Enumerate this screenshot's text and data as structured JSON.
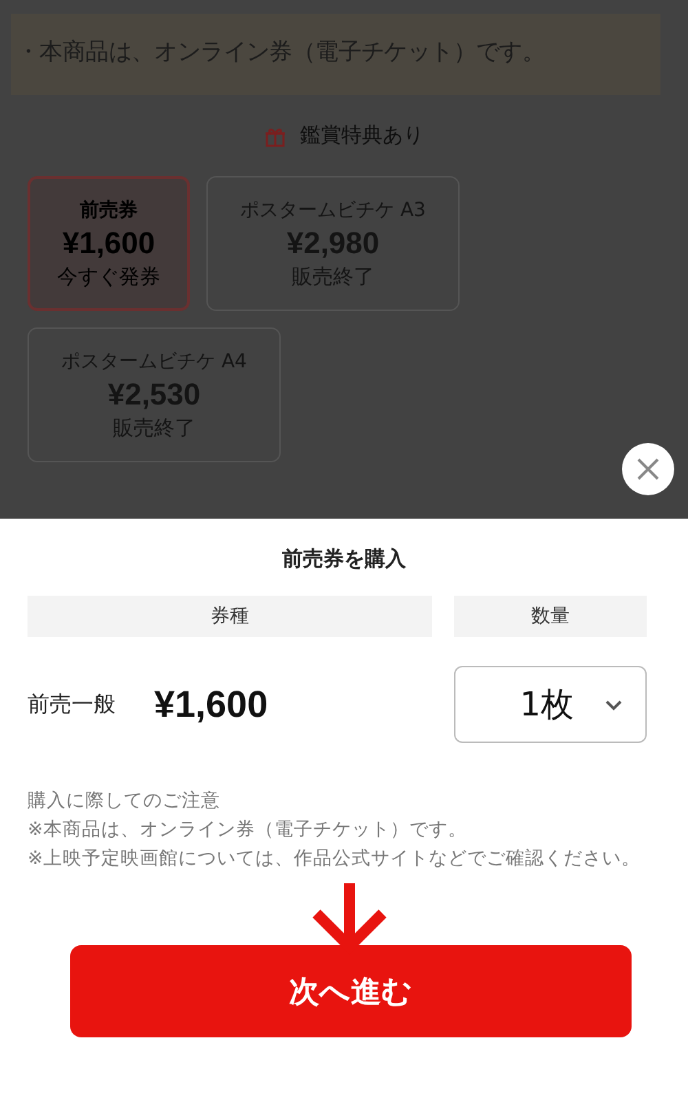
{
  "background": {
    "notice": "・本商品は、オンライン券（電子チケット）です。",
    "bonus": "鑑賞特典あり",
    "tickets": [
      {
        "name": "前売券",
        "price": "¥1,600",
        "status": "今すぐ発券",
        "selected": true,
        "disabled": false
      },
      {
        "name": "ポスタームビチケ A3",
        "price": "¥2,980",
        "status": "販売終了",
        "selected": false,
        "disabled": true
      },
      {
        "name": "ポスタームビチケ A4",
        "price": "¥2,530",
        "status": "販売終了",
        "selected": false,
        "disabled": true
      }
    ]
  },
  "sheet": {
    "title": "前売券を購入",
    "columns": [
      "券種",
      "数量"
    ],
    "row": {
      "type": "前売一般",
      "price": "¥1,600",
      "quantity": "1枚"
    },
    "notes": [
      "購入に際してのご注意",
      "※本商品は、オンライン券（電子チケット）です。",
      "※上映予定映画館については、作品公式サイトなどでご確認ください。"
    ],
    "next_button": "次へ進む"
  }
}
